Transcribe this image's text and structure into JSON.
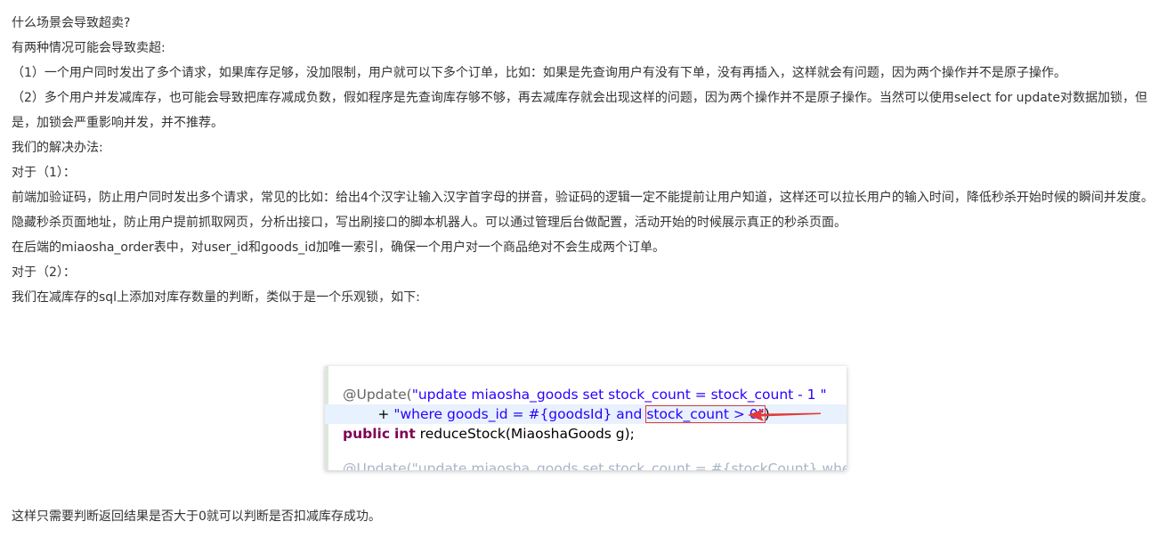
{
  "article": {
    "lines": [
      "什么场景会导致超卖?",
      "有两种情况可能会导致卖超:",
      "（1）一个用户同时发出了多个请求，如果库存足够，没加限制，用户就可以下多个订单，比如：如果是先查询用户有没有下单，没有再插入，这样就会有问题，因为两个操作并不是原子操作。",
      "（2）多个用户并发减库存，也可能会导致把库存减成负数，假如程序是先查询库存够不够，再去减库存就会出现这样的问题，因为两个操作并不是原子操作。当然可以使用select for update对数据加锁，但是，加锁会严重影响并发，并不推荐。",
      "我们的解决办法:",
      "对于（1）：",
      "前端加验证码，防止用户同时发出多个请求，常见的比如：给出4个汉字让输入汉字首字母的拼音，验证码的逻辑一定不能提前让用户知道，这样还可以拉长用户的输入时间，降低秒杀开始时候的瞬间并发度。",
      "隐藏秒杀页面地址，防止用户提前抓取网页，分析出接口，写出刷接口的脚本机器人。可以通过管理后台做配置，活动开始的时候展示真正的秒杀页面。",
      "在后端的miaosha_order表中，对user_id和goods_id加唯一索引，确保一个用户对一个商品绝对不会生成两个订单。",
      "对于（2）：",
      "我们在减库存的sql上添加对库存数量的判断，类似于是一个乐观锁，如下:"
    ],
    "footer": "这样只需要判断返回结果是否大于0就可以判断是否扣减库存成功。"
  },
  "code": {
    "l1_annotation": "@Update(",
    "l1_string": "\"update miaosha_goods set stock_count = stock_count - 1 \"",
    "l2_indent": "        + ",
    "l2_string": "\"where goods_id = #{goodsId} and ",
    "l2_highlight": "stock_count > 0\"",
    "l2_close": ")",
    "l3_kw1": "public",
    "l3_kw2": "int",
    "l3_rest": " reduceStock(MiaoshaGoods g);",
    "l4_partial": "@Update(\"update miaosha_goods set stock_count = #{stockCount} where"
  },
  "colors": {
    "annotation": "#646464",
    "string": "#2a00ff",
    "keyword": "#7f0055",
    "highlight_border": "#e33b3b",
    "arrow": "#e33b3b",
    "current_line": "#e8f2fe"
  }
}
